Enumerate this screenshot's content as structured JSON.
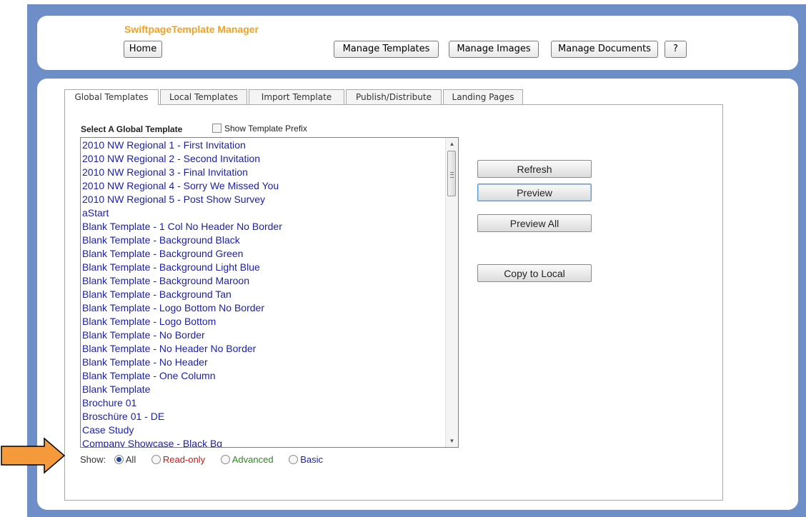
{
  "header": {
    "title": "SwiftpageTemplate Manager",
    "home_label": "Home",
    "manage_templates_label": "Manage Templates",
    "manage_images_label": "Manage Images",
    "manage_documents_label": "Manage Documents",
    "help_label": "?"
  },
  "tabs": [
    {
      "label": "Global Templates",
      "active": true
    },
    {
      "label": "Local Templates",
      "active": false
    },
    {
      "label": "Import Template",
      "active": false
    },
    {
      "label": "Publish/Distribute",
      "active": false
    },
    {
      "label": "Landing Pages",
      "active": false
    }
  ],
  "global": {
    "select_label": "Select A Global Template",
    "show_prefix_label": "Show Template Prefix",
    "show_prefix_checked": false,
    "templates": [
      "2010 NW Regional 1 - First Invitation",
      "2010 NW Regional 2 - Second Invitation",
      "2010 NW Regional 3 - Final Invitation",
      "2010 NW Regional 4 - Sorry We Missed You",
      "2010 NW Regional 5 - Post Show Survey",
      "aStart",
      "Blank Template - 1 Col No Header No Border",
      "Blank Template - Background Black",
      "Blank Template - Background Green",
      "Blank Template - Background Light Blue",
      "Blank Template - Background Maroon",
      "Blank Template - Background Tan",
      "Blank Template - Logo Bottom No Border",
      "Blank Template - Logo Bottom",
      "Blank Template - No Border",
      "Blank Template - No Header No Border",
      "Blank Template - No Header",
      "Blank Template - One Column",
      "Blank Template",
      "Brochure 01",
      "Broschüre 01 - DE",
      "Case Study",
      "Company Showcase - Black Bg"
    ]
  },
  "actions": {
    "refresh": "Refresh",
    "preview": "Preview",
    "preview_all": "Preview All",
    "copy_to_local": "Copy to Local"
  },
  "filter": {
    "label": "Show:",
    "selected": "All",
    "options": [
      {
        "label": "All",
        "color": "#333333"
      },
      {
        "label": "Read-only",
        "color": "#d01515"
      },
      {
        "label": "Advanced",
        "color": "#2d8a1f"
      },
      {
        "label": "Basic",
        "color": "#1b1fa8"
      }
    ]
  },
  "colors": {
    "frame": "#6d8ec7",
    "title": "#f2a121",
    "list_text": "#1b1fa8",
    "callout_arrow": "#f59a3b"
  }
}
